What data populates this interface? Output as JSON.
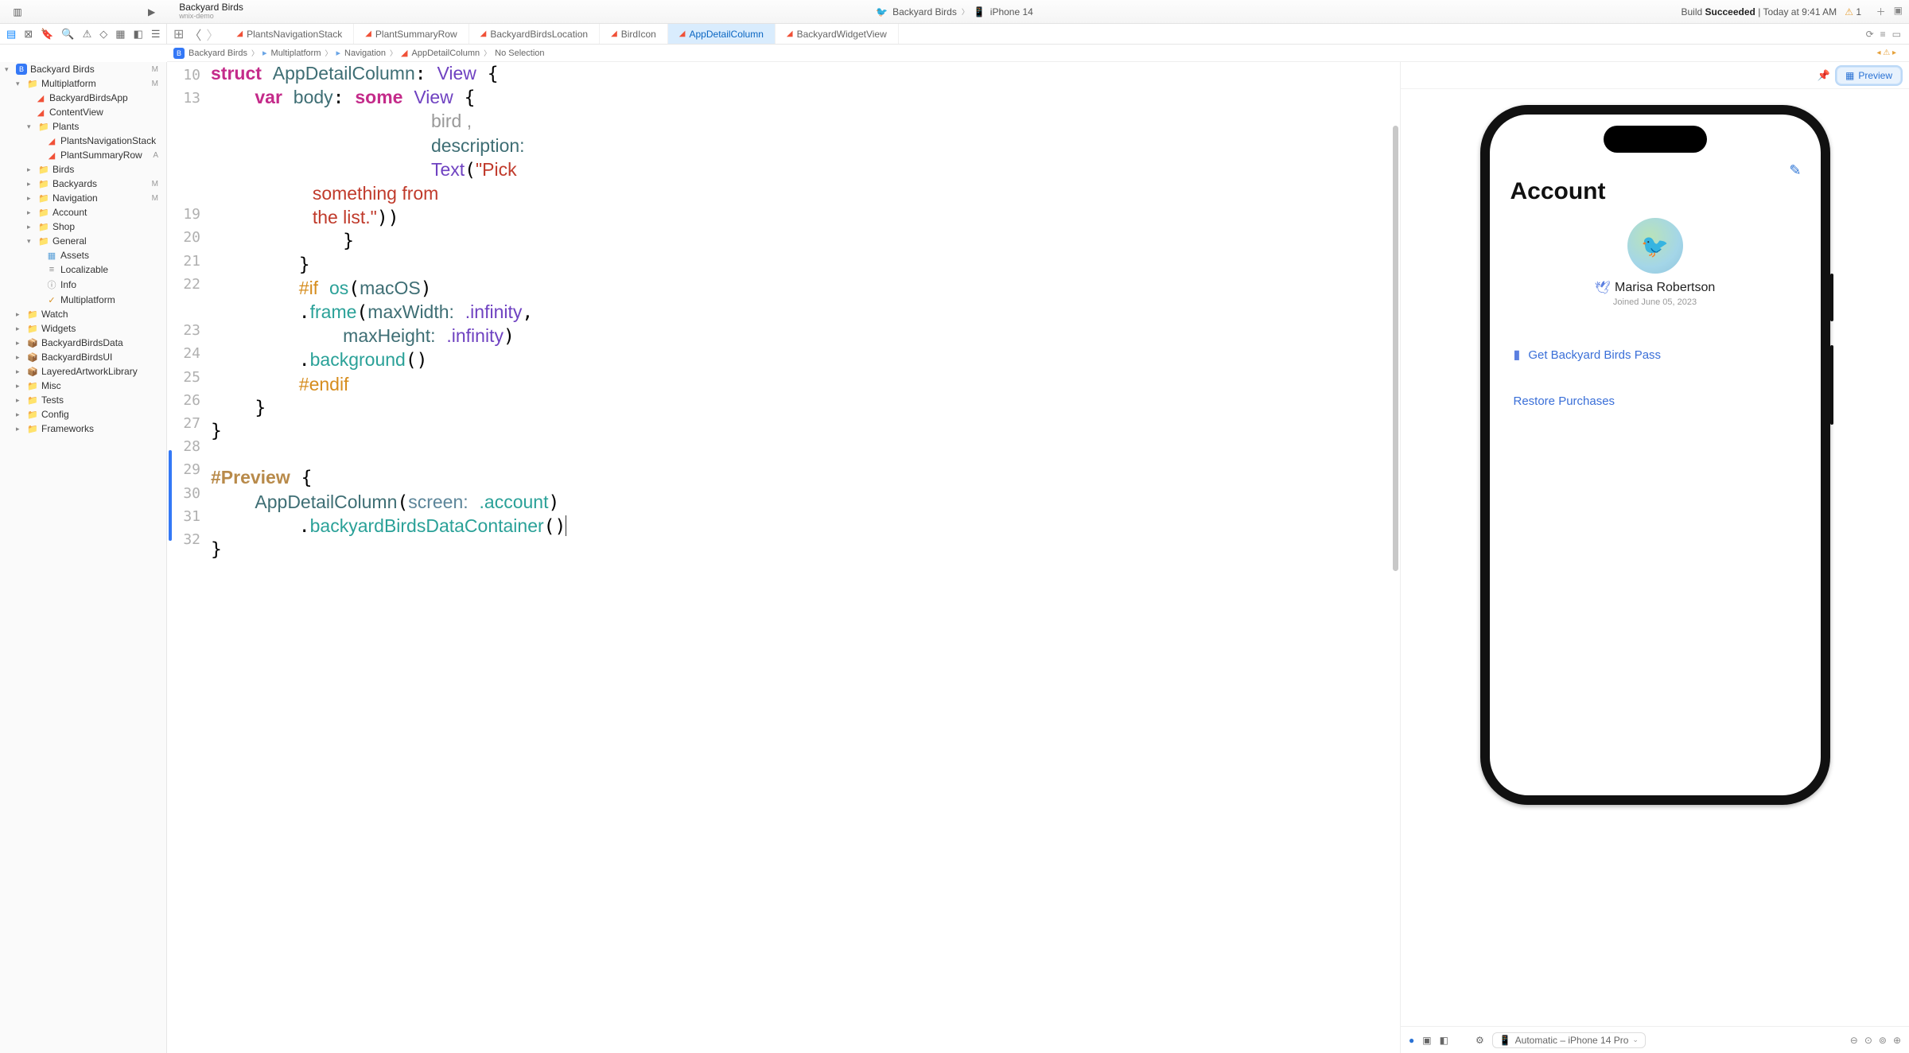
{
  "titlebar": {
    "project_name": "Backyard Birds",
    "project_sub": "wnix-demo",
    "crumb1": "Backyard Birds",
    "crumb2": "iPhone 14",
    "status_prefix": "Build",
    "status_word": "Succeeded",
    "status_time": "Today at 9:41 AM",
    "warn_count": "1"
  },
  "tabs": [
    {
      "label": "PlantsNavigationStack"
    },
    {
      "label": "PlantSummaryRow"
    },
    {
      "label": "BackyardBirdsLocation"
    },
    {
      "label": "BirdIcon"
    },
    {
      "label": "AppDetailColumn"
    },
    {
      "label": "BackyardWidgetView"
    }
  ],
  "breadcrumb": {
    "items": [
      "Backyard Birds",
      "Multiplatform",
      "Navigation",
      "AppDetailColumn",
      "No Selection"
    ]
  },
  "sidebar": {
    "root": {
      "label": "Backyard Birds",
      "badge": "M"
    },
    "multiplatform": {
      "label": "Multiplatform",
      "badge": "M"
    },
    "app": {
      "label": "BackyardBirdsApp"
    },
    "content": {
      "label": "ContentView"
    },
    "plants": {
      "label": "Plants"
    },
    "plants_nav": {
      "label": "PlantsNavigationStack"
    },
    "plant_sum": {
      "label": "PlantSummaryRow",
      "badge": "A"
    },
    "birds": {
      "label": "Birds"
    },
    "backyards": {
      "label": "Backyards",
      "badge": "M"
    },
    "navigation": {
      "label": "Navigation",
      "badge": "M"
    },
    "account": {
      "label": "Account"
    },
    "shop": {
      "label": "Shop"
    },
    "general": {
      "label": "General"
    },
    "assets": {
      "label": "Assets"
    },
    "localizable": {
      "label": "Localizable"
    },
    "info": {
      "label": "Info"
    },
    "multi2": {
      "label": "Multiplatform"
    },
    "watch": {
      "label": "Watch"
    },
    "widgets": {
      "label": "Widgets"
    },
    "bbdata": {
      "label": "BackyardBirdsData"
    },
    "bbui": {
      "label": "BackyardBirdsUI"
    },
    "layered": {
      "label": "LayeredArtworkLibrary"
    },
    "misc": {
      "label": "Misc"
    },
    "tests": {
      "label": "Tests"
    },
    "config": {
      "label": "Config"
    },
    "frameworks": {
      "label": "Frameworks"
    }
  },
  "code": {
    "lines": [
      "10",
      "13",
      "",
      "",
      "",
      "",
      "19",
      "20",
      "21",
      "22",
      "",
      "23",
      "24",
      "25",
      "26",
      "27",
      "28",
      "29",
      "30",
      "31",
      "32"
    ],
    "l10_struct": "struct",
    "l10_name": "AppDetailColumn",
    "l10_view": "View",
    "l13_var": "var",
    "l13_body": "body",
    "l13_some": "some",
    "l13_view": "View",
    "frag_bird": "bird ,",
    "frag_desc": "description:",
    "frag_text": "Text",
    "frag_pick": "\"Pick ",
    "frag_some": "something from ",
    "frag_list": "the list.\"",
    "l21_if": "#if",
    "l21_os": "os",
    "l21_mac": "macOS",
    "l22_frame": "frame",
    "l22_mw": "maxWidth:",
    "l22_inf": ".infinity",
    "l22b_mh": "maxHeight:",
    "l23_bg": "background",
    "l24_endif": "#endif",
    "l28_prev": "#Preview",
    "l29_adc": "AppDetailColumn",
    "l29_screen": "screen:",
    "l29_acc": ".account",
    "l30_bbdc": "backyardBirdsDataContainer"
  },
  "preview": {
    "btn_label": "Preview",
    "account_title": "Account",
    "user_name": "Marisa Robertson",
    "joined": "Joined June 05, 2023",
    "pass_label": "Get Backyard Birds Pass",
    "restore": "Restore Purchases",
    "device": "Automatic – iPhone 14 Pro"
  }
}
